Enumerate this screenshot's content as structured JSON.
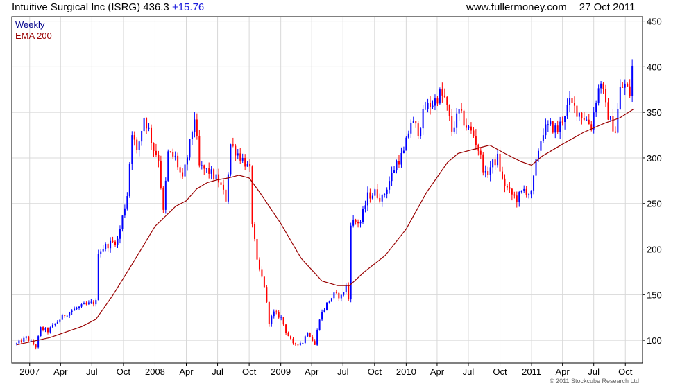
{
  "header": {
    "title": "Intuitive Surgical Inc (ISRG)",
    "price": "436.3",
    "change": "+15.76",
    "site": "www.fullermoney.com",
    "date": "27 Oct 2011"
  },
  "footer": {
    "copyright": "© 2011 Stockcube Research Ltd"
  },
  "chart_data": {
    "type": "candlestick",
    "legend": [
      "Weekly",
      "EMA 200"
    ],
    "colors": {
      "up": "#0000ff",
      "down": "#ff0000",
      "ema": "#990000",
      "grid": "#d8d8d8",
      "legend_weekly": "#00008b",
      "legend_ema": "#990000"
    },
    "grid": true,
    "ylim": [
      75,
      455
    ],
    "y_ticks": [
      100,
      150,
      200,
      250,
      300,
      350,
      400,
      450
    ],
    "x_ticks": [
      "2007",
      "Apr",
      "Jul",
      "Oct",
      "2008",
      "Apr",
      "Jul",
      "Oct",
      "2009",
      "Apr",
      "Jul",
      "Oct",
      "2010",
      "Apr",
      "Jul",
      "Oct",
      "2011",
      "Apr",
      "Jul",
      "Oct"
    ],
    "x_tick_dates": [
      "2007-01-01",
      "2007-04-01",
      "2007-07-01",
      "2007-10-01",
      "2008-01-01",
      "2008-04-01",
      "2008-07-01",
      "2008-10-01",
      "2009-01-01",
      "2009-04-01",
      "2009-07-01",
      "2009-10-01",
      "2010-01-01",
      "2010-04-01",
      "2010-07-01",
      "2010-10-01",
      "2011-01-01",
      "2011-04-01",
      "2011-07-01",
      "2011-10-01"
    ],
    "xlim": [
      "2006-11-10",
      "2011-11-20"
    ],
    "price_path": [
      [
        "2006-11-24",
        96
      ],
      [
        "2006-12-22",
        103
      ],
      [
        "2007-01-19",
        93
      ],
      [
        "2007-02-02",
        113
      ],
      [
        "2007-02-23",
        110
      ],
      [
        "2007-03-16",
        118
      ],
      [
        "2007-04-13",
        128
      ],
      [
        "2007-05-11",
        134
      ],
      [
        "2007-06-15",
        139
      ],
      [
        "2007-07-13",
        142
      ],
      [
        "2007-07-20",
        198
      ],
      [
        "2007-08-17",
        205
      ],
      [
        "2007-09-14",
        210
      ],
      [
        "2007-10-12",
        260
      ],
      [
        "2007-10-26",
        330
      ],
      [
        "2007-11-09",
        305
      ],
      [
        "2007-11-30",
        345
      ],
      [
        "2007-12-14",
        330
      ],
      [
        "2007-12-28",
        310
      ],
      [
        "2008-01-11",
        300
      ],
      [
        "2008-01-25",
        240
      ],
      [
        "2008-02-08",
        305
      ],
      [
        "2008-02-29",
        300
      ],
      [
        "2008-03-21",
        275
      ],
      [
        "2008-04-11",
        315
      ],
      [
        "2008-04-25",
        345
      ],
      [
        "2008-05-09",
        290
      ],
      [
        "2008-06-06",
        285
      ],
      [
        "2008-07-04",
        275
      ],
      [
        "2008-07-25",
        255
      ],
      [
        "2008-08-08",
        315
      ],
      [
        "2008-08-29",
        305
      ],
      [
        "2008-09-19",
        295
      ],
      [
        "2008-10-03",
        285
      ],
      [
        "2008-10-10",
        230
      ],
      [
        "2008-10-24",
        185
      ],
      [
        "2008-11-14",
        160
      ],
      [
        "2008-11-28",
        120
      ],
      [
        "2008-12-12",
        130
      ],
      [
        "2009-01-02",
        125
      ],
      [
        "2009-01-16",
        110
      ],
      [
        "2009-02-06",
        95
      ],
      [
        "2009-03-06",
        98
      ],
      [
        "2009-03-20",
        110
      ],
      [
        "2009-04-10",
        95
      ],
      [
        "2009-04-24",
        125
      ],
      [
        "2009-05-15",
        140
      ],
      [
        "2009-06-05",
        150
      ],
      [
        "2009-06-26",
        148
      ],
      [
        "2009-07-10",
        160
      ],
      [
        "2009-07-17",
        145
      ],
      [
        "2009-07-24",
        230
      ],
      [
        "2009-08-21",
        230
      ],
      [
        "2009-09-11",
        258
      ],
      [
        "2009-10-02",
        262
      ],
      [
        "2009-10-23",
        255
      ],
      [
        "2009-11-13",
        275
      ],
      [
        "2009-12-04",
        295
      ],
      [
        "2009-12-25",
        305
      ],
      [
        "2010-01-15",
        340
      ],
      [
        "2010-02-05",
        330
      ],
      [
        "2010-02-26",
        355
      ],
      [
        "2010-03-19",
        360
      ],
      [
        "2010-04-09",
        370
      ],
      [
        "2010-04-23",
        365
      ],
      [
        "2010-05-14",
        330
      ],
      [
        "2010-06-04",
        350
      ],
      [
        "2010-06-25",
        335
      ],
      [
        "2010-07-16",
        325
      ],
      [
        "2010-07-30",
        310
      ],
      [
        "2010-08-20",
        280
      ],
      [
        "2010-09-03",
        290
      ],
      [
        "2010-09-24",
        300
      ],
      [
        "2010-10-08",
        275
      ],
      [
        "2010-10-29",
        262
      ],
      [
        "2010-11-19",
        255
      ],
      [
        "2010-12-10",
        265
      ],
      [
        "2010-12-31",
        260
      ],
      [
        "2011-01-21",
        310
      ],
      [
        "2011-02-04",
        330
      ],
      [
        "2011-02-25",
        335
      ],
      [
        "2011-03-18",
        330
      ],
      [
        "2011-04-08",
        350
      ],
      [
        "2011-04-22",
        360
      ],
      [
        "2011-05-13",
        352
      ],
      [
        "2011-06-03",
        345
      ],
      [
        "2011-06-24",
        335
      ],
      [
        "2011-07-08",
        365
      ],
      [
        "2011-07-22",
        385
      ],
      [
        "2011-08-05",
        355
      ],
      [
        "2011-08-19",
        340
      ],
      [
        "2011-09-02",
        330
      ],
      [
        "2011-09-16",
        375
      ],
      [
        "2011-09-30",
        380
      ],
      [
        "2011-10-14",
        370
      ],
      [
        "2011-10-21",
        400
      ],
      [
        "2011-10-27",
        436
      ]
    ],
    "ema_path": [
      [
        "2006-11-24",
        95
      ],
      [
        "2007-03-01",
        103
      ],
      [
        "2007-06-01",
        115
      ],
      [
        "2007-07-13",
        123
      ],
      [
        "2007-09-01",
        150
      ],
      [
        "2007-11-01",
        187
      ],
      [
        "2008-01-01",
        225
      ],
      [
        "2008-03-01",
        247
      ],
      [
        "2008-04-01",
        253
      ],
      [
        "2008-05-01",
        266
      ],
      [
        "2008-06-01",
        273
      ],
      [
        "2008-07-01",
        276
      ],
      [
        "2008-08-01",
        278
      ],
      [
        "2008-09-01",
        281
      ],
      [
        "2008-10-01",
        278
      ],
      [
        "2008-11-01",
        262
      ],
      [
        "2009-01-01",
        228
      ],
      [
        "2009-03-01",
        190
      ],
      [
        "2009-05-01",
        165
      ],
      [
        "2009-06-15",
        160
      ],
      [
        "2009-07-20",
        160
      ],
      [
        "2009-09-01",
        175
      ],
      [
        "2009-11-01",
        193
      ],
      [
        "2010-01-01",
        222
      ],
      [
        "2010-03-01",
        262
      ],
      [
        "2010-05-01",
        295
      ],
      [
        "2010-06-01",
        305
      ],
      [
        "2010-08-01",
        311
      ],
      [
        "2010-09-01",
        314
      ],
      [
        "2010-10-15",
        305
      ],
      [
        "2010-12-01",
        296
      ],
      [
        "2011-01-01",
        292
      ],
      [
        "2011-02-01",
        302
      ],
      [
        "2011-04-01",
        315
      ],
      [
        "2011-06-01",
        328
      ],
      [
        "2011-08-01",
        338
      ],
      [
        "2011-09-15",
        344
      ],
      [
        "2011-10-27",
        354
      ]
    ]
  }
}
